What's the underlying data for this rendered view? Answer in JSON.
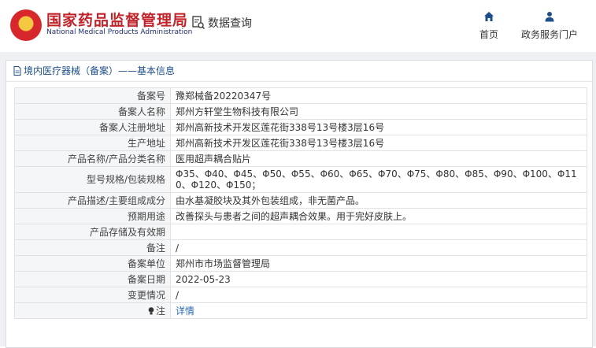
{
  "header": {
    "site_name": "国家药品监督管理局",
    "site_name_en": "National Medical Products Administration",
    "query_label": "数据查询",
    "nav": [
      {
        "label": "首页",
        "icon": "home-icon"
      },
      {
        "label": "政务服务门户",
        "icon": "user-icon"
      }
    ]
  },
  "panel": {
    "title": "境内医疗器械（备案）——基本信息"
  },
  "rows": [
    {
      "label": "备案号",
      "value": "豫郑械备20220347号"
    },
    {
      "label": "备案人名称",
      "value": "郑州方轩堂生物科技有限公司"
    },
    {
      "label": "备案人注册地址",
      "value": "郑州高新技术开发区莲花街338号13号楼3层16号"
    },
    {
      "label": "生产地址",
      "value": "郑州高新技术开发区莲花街338号13号楼3层16号"
    },
    {
      "label": "产品名称/产品分类名称",
      "value": "医用超声耦合贴片"
    },
    {
      "label": "型号规格/包装规格",
      "value": "Φ35、Φ40、Φ45、Φ50、Φ55、Φ60、Φ65、Φ70、Φ75、Φ80、Φ85、Φ90、Φ100、Φ110、Φ120、Φ150；"
    },
    {
      "label": "产品描述/主要组成成分",
      "value": "由水基凝胶块及其外包装组成，非无菌产品。"
    },
    {
      "label": "预期用途",
      "value": "改善探头与患者之间的超声耦合效果。用于完好皮肤上。"
    },
    {
      "label": "产品存储及有效期",
      "value": ""
    },
    {
      "label": "备注",
      "value": "/"
    },
    {
      "label": "备案单位",
      "value": "郑州市市场监督管理局"
    },
    {
      "label": "备案日期",
      "value": "2022-05-23"
    },
    {
      "label": "变更情况",
      "value": "/"
    },
    {
      "label": "注",
      "value": "详情",
      "icon": "bulb-icon"
    }
  ]
}
